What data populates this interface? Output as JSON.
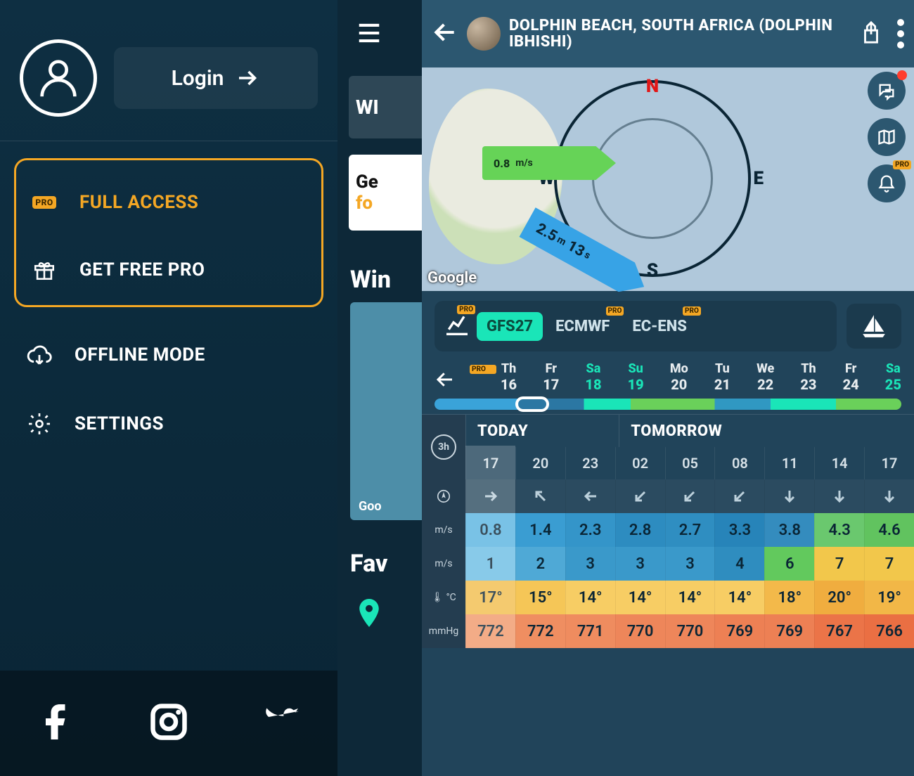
{
  "drawer": {
    "login": "Login",
    "pro_badge": "PRO",
    "full_access": "FULL ACCESS",
    "get_free_pro": "GET FREE PRO",
    "offline_mode": "OFFLINE MODE",
    "settings": "SETTINGS"
  },
  "middle": {
    "tab": "WI",
    "promo_l1": "Ge",
    "promo_l2": "fo",
    "heading1": "Win",
    "heading2": "Fav",
    "map_attr": "Goo"
  },
  "header": {
    "title": "DOLPHIN BEACH, SOUTH AFRICA (DOLPHIN IBHISHI)"
  },
  "compass": {
    "N": "N",
    "E": "E",
    "S": "S",
    "W": "W",
    "wind_val": "0.8",
    "wind_unit": "m/s",
    "swell_h": "2.5",
    "swell_h_unit": "m",
    "swell_p": "13",
    "swell_p_unit": "s",
    "map_attr": "Google"
  },
  "floaters": {
    "pro": "PRO"
  },
  "models": {
    "pro": "PRO",
    "items": [
      {
        "label": "GFS27",
        "active": true,
        "pro": false
      },
      {
        "label": "ECMWF",
        "active": false,
        "pro": true
      },
      {
        "label": "EC-ENS",
        "active": false,
        "pro": true
      }
    ]
  },
  "day_strip": {
    "pro": "PRO",
    "days": [
      {
        "dow": "Th",
        "num": "16",
        "wk": false
      },
      {
        "dow": "Fr",
        "num": "17",
        "wk": false
      },
      {
        "dow": "Sa",
        "num": "18",
        "wk": true
      },
      {
        "dow": "Su",
        "num": "19",
        "wk": true
      },
      {
        "dow": "Mo",
        "num": "20",
        "wk": false
      },
      {
        "dow": "Tu",
        "num": "21",
        "wk": false
      },
      {
        "dow": "We",
        "num": "22",
        "wk": false
      },
      {
        "dow": "Th",
        "num": "23",
        "wk": false
      },
      {
        "dow": "Fr",
        "num": "24",
        "wk": false
      },
      {
        "dow": "Sa",
        "num": "25",
        "wk": true
      }
    ]
  },
  "table": {
    "interval": "3h",
    "group_today": "TODAY",
    "group_tomorrow": "TOMORROW",
    "hours": [
      "17",
      "20",
      "23",
      "02",
      "05",
      "08",
      "11",
      "14",
      "17"
    ],
    "row_labels": {
      "dir": "",
      "ms1": "m/s",
      "ms2": "m/s",
      "temp": "°C",
      "press": "mmHg"
    },
    "temp_icon": "🌡",
    "dir": [
      "→",
      "↖",
      "←",
      "↙",
      "↙",
      "↙",
      "↓",
      "↓",
      "↓"
    ],
    "ms1": [
      "0.8",
      "1.4",
      "2.3",
      "2.8",
      "2.7",
      "3.3",
      "3.8",
      "4.3",
      "4.6"
    ],
    "ms2": [
      "1",
      "2",
      "3",
      "3",
      "3",
      "4",
      "6",
      "7",
      "7"
    ],
    "temp": [
      "17°",
      "15°",
      "14°",
      "14°",
      "14°",
      "14°",
      "18°",
      "20°",
      "19°"
    ],
    "press": [
      "772",
      "772",
      "771",
      "770",
      "770",
      "769",
      "769",
      "767",
      "766"
    ]
  },
  "colors": {
    "ms1": [
      "#58b3e0",
      "#3a9dd2",
      "#3495c9",
      "#2d8cc0",
      "#2f8ec1",
      "#2784b9",
      "#348cbe",
      "#6ac86e",
      "#61c35f"
    ],
    "ms2": [
      "#6bbde4",
      "#4fa9d6",
      "#3a99ca",
      "#3a99ca",
      "#3a99ca",
      "#2f8dbf",
      "#62c95d",
      "#f2c74b",
      "#f2c74b"
    ],
    "temp": [
      "#f2bd4b",
      "#f5c657",
      "#f7cd64",
      "#f7cd64",
      "#f7cd64",
      "#f7cd64",
      "#f3b94a",
      "#f0ad3f",
      "#f2b747"
    ],
    "press": [
      "#f19869",
      "#ef8e61",
      "#ef8c5f",
      "#ee865a",
      "#ee865a",
      "#ed8054",
      "#ed8054",
      "#eb7448",
      "#ea6f43"
    ]
  }
}
